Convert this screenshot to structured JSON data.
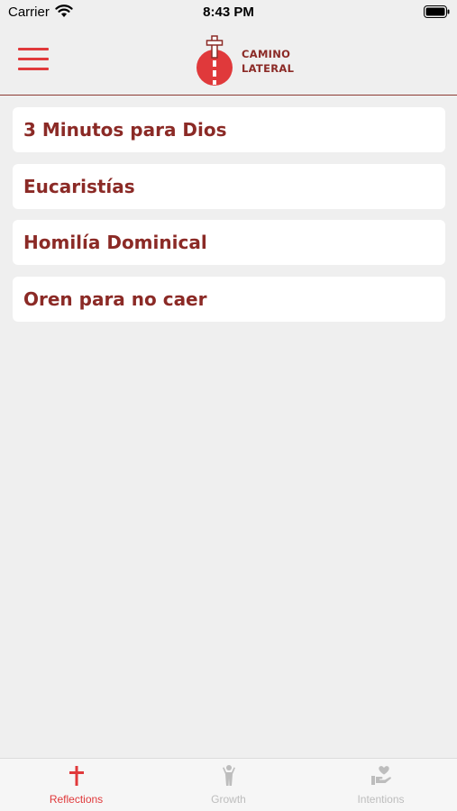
{
  "status_bar": {
    "carrier": "Carrier",
    "time": "8:43 PM"
  },
  "header": {
    "logo_line1": "CAMINO",
    "logo_line2": "LATERAL",
    "accent_color": "#e0393b",
    "brand_color": "#8b2a26"
  },
  "list": {
    "items": [
      {
        "label": "3 Minutos para Dios"
      },
      {
        "label": "Eucaristías"
      },
      {
        "label": "Homilía Dominical"
      },
      {
        "label": "Oren para no caer"
      }
    ]
  },
  "tab_bar": {
    "tabs": [
      {
        "label": "Reflections",
        "icon": "cross-icon",
        "active": true
      },
      {
        "label": "Growth",
        "icon": "person-icon",
        "active": false
      },
      {
        "label": "Intentions",
        "icon": "heart-hand-icon",
        "active": false
      }
    ]
  }
}
